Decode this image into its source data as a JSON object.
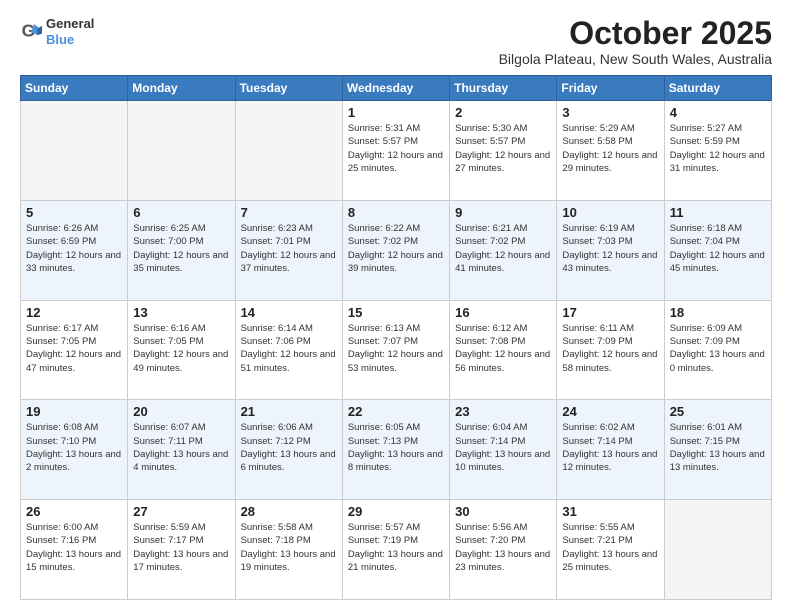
{
  "header": {
    "logo": {
      "line1": "General",
      "line2": "Blue"
    },
    "title": "October 2025",
    "subtitle": "Bilgola Plateau, New South Wales, Australia"
  },
  "weekdays": [
    "Sunday",
    "Monday",
    "Tuesday",
    "Wednesday",
    "Thursday",
    "Friday",
    "Saturday"
  ],
  "weeks": [
    [
      {
        "day": "",
        "empty": true
      },
      {
        "day": "",
        "empty": true
      },
      {
        "day": "",
        "empty": true
      },
      {
        "day": "1",
        "sunrise": "Sunrise: 5:31 AM",
        "sunset": "Sunset: 5:57 PM",
        "daylight": "Daylight: 12 hours and 25 minutes."
      },
      {
        "day": "2",
        "sunrise": "Sunrise: 5:30 AM",
        "sunset": "Sunset: 5:57 PM",
        "daylight": "Daylight: 12 hours and 27 minutes."
      },
      {
        "day": "3",
        "sunrise": "Sunrise: 5:29 AM",
        "sunset": "Sunset: 5:58 PM",
        "daylight": "Daylight: 12 hours and 29 minutes."
      },
      {
        "day": "4",
        "sunrise": "Sunrise: 5:27 AM",
        "sunset": "Sunset: 5:59 PM",
        "daylight": "Daylight: 12 hours and 31 minutes."
      }
    ],
    [
      {
        "day": "5",
        "sunrise": "Sunrise: 6:26 AM",
        "sunset": "Sunset: 6:59 PM",
        "daylight": "Daylight: 12 hours and 33 minutes."
      },
      {
        "day": "6",
        "sunrise": "Sunrise: 6:25 AM",
        "sunset": "Sunset: 7:00 PM",
        "daylight": "Daylight: 12 hours and 35 minutes."
      },
      {
        "day": "7",
        "sunrise": "Sunrise: 6:23 AM",
        "sunset": "Sunset: 7:01 PM",
        "daylight": "Daylight: 12 hours and 37 minutes."
      },
      {
        "day": "8",
        "sunrise": "Sunrise: 6:22 AM",
        "sunset": "Sunset: 7:02 PM",
        "daylight": "Daylight: 12 hours and 39 minutes."
      },
      {
        "day": "9",
        "sunrise": "Sunrise: 6:21 AM",
        "sunset": "Sunset: 7:02 PM",
        "daylight": "Daylight: 12 hours and 41 minutes."
      },
      {
        "day": "10",
        "sunrise": "Sunrise: 6:19 AM",
        "sunset": "Sunset: 7:03 PM",
        "daylight": "Daylight: 12 hours and 43 minutes."
      },
      {
        "day": "11",
        "sunrise": "Sunrise: 6:18 AM",
        "sunset": "Sunset: 7:04 PM",
        "daylight": "Daylight: 12 hours and 45 minutes."
      }
    ],
    [
      {
        "day": "12",
        "sunrise": "Sunrise: 6:17 AM",
        "sunset": "Sunset: 7:05 PM",
        "daylight": "Daylight: 12 hours and 47 minutes."
      },
      {
        "day": "13",
        "sunrise": "Sunrise: 6:16 AM",
        "sunset": "Sunset: 7:05 PM",
        "daylight": "Daylight: 12 hours and 49 minutes."
      },
      {
        "day": "14",
        "sunrise": "Sunrise: 6:14 AM",
        "sunset": "Sunset: 7:06 PM",
        "daylight": "Daylight: 12 hours and 51 minutes."
      },
      {
        "day": "15",
        "sunrise": "Sunrise: 6:13 AM",
        "sunset": "Sunset: 7:07 PM",
        "daylight": "Daylight: 12 hours and 53 minutes."
      },
      {
        "day": "16",
        "sunrise": "Sunrise: 6:12 AM",
        "sunset": "Sunset: 7:08 PM",
        "daylight": "Daylight: 12 hours and 56 minutes."
      },
      {
        "day": "17",
        "sunrise": "Sunrise: 6:11 AM",
        "sunset": "Sunset: 7:09 PM",
        "daylight": "Daylight: 12 hours and 58 minutes."
      },
      {
        "day": "18",
        "sunrise": "Sunrise: 6:09 AM",
        "sunset": "Sunset: 7:09 PM",
        "daylight": "Daylight: 13 hours and 0 minutes."
      }
    ],
    [
      {
        "day": "19",
        "sunrise": "Sunrise: 6:08 AM",
        "sunset": "Sunset: 7:10 PM",
        "daylight": "Daylight: 13 hours and 2 minutes."
      },
      {
        "day": "20",
        "sunrise": "Sunrise: 6:07 AM",
        "sunset": "Sunset: 7:11 PM",
        "daylight": "Daylight: 13 hours and 4 minutes."
      },
      {
        "day": "21",
        "sunrise": "Sunrise: 6:06 AM",
        "sunset": "Sunset: 7:12 PM",
        "daylight": "Daylight: 13 hours and 6 minutes."
      },
      {
        "day": "22",
        "sunrise": "Sunrise: 6:05 AM",
        "sunset": "Sunset: 7:13 PM",
        "daylight": "Daylight: 13 hours and 8 minutes."
      },
      {
        "day": "23",
        "sunrise": "Sunrise: 6:04 AM",
        "sunset": "Sunset: 7:14 PM",
        "daylight": "Daylight: 13 hours and 10 minutes."
      },
      {
        "day": "24",
        "sunrise": "Sunrise: 6:02 AM",
        "sunset": "Sunset: 7:14 PM",
        "daylight": "Daylight: 13 hours and 12 minutes."
      },
      {
        "day": "25",
        "sunrise": "Sunrise: 6:01 AM",
        "sunset": "Sunset: 7:15 PM",
        "daylight": "Daylight: 13 hours and 13 minutes."
      }
    ],
    [
      {
        "day": "26",
        "sunrise": "Sunrise: 6:00 AM",
        "sunset": "Sunset: 7:16 PM",
        "daylight": "Daylight: 13 hours and 15 minutes."
      },
      {
        "day": "27",
        "sunrise": "Sunrise: 5:59 AM",
        "sunset": "Sunset: 7:17 PM",
        "daylight": "Daylight: 13 hours and 17 minutes."
      },
      {
        "day": "28",
        "sunrise": "Sunrise: 5:58 AM",
        "sunset": "Sunset: 7:18 PM",
        "daylight": "Daylight: 13 hours and 19 minutes."
      },
      {
        "day": "29",
        "sunrise": "Sunrise: 5:57 AM",
        "sunset": "Sunset: 7:19 PM",
        "daylight": "Daylight: 13 hours and 21 minutes."
      },
      {
        "day": "30",
        "sunrise": "Sunrise: 5:56 AM",
        "sunset": "Sunset: 7:20 PM",
        "daylight": "Daylight: 13 hours and 23 minutes."
      },
      {
        "day": "31",
        "sunrise": "Sunrise: 5:55 AM",
        "sunset": "Sunset: 7:21 PM",
        "daylight": "Daylight: 13 hours and 25 minutes."
      },
      {
        "day": "",
        "empty": true
      }
    ]
  ]
}
